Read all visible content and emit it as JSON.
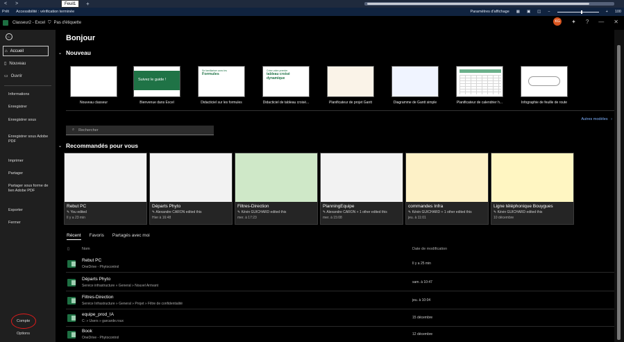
{
  "browser": {
    "back": "<",
    "forward": ">",
    "sheet_tab": "Feuil1",
    "new_tab": "+"
  },
  "statusbar": {
    "ready": "Prêt",
    "accessibility": "Accessibilité : vérification terminée",
    "display_settings": "Paramètres d'affichage",
    "zoom": "100"
  },
  "titlebar": {
    "filename": "Classeur2 - Excel",
    "label": "Pas d'étiquette",
    "avatar": "KG",
    "help": "?"
  },
  "leftnav": {
    "items": [
      {
        "label": "Accueil"
      },
      {
        "label": "Nouveau"
      },
      {
        "label": "Ouvrir"
      }
    ],
    "sub": [
      "Informations",
      "Enregistrer",
      "Enregistrer sous",
      "Enregistrer sous Adobe PDF",
      "Imprimer",
      "Partager",
      "Partager sous forme de lien Adobe PDF",
      "Exporter",
      "Fermer"
    ],
    "compte": "Compte",
    "options": "Options"
  },
  "main": {
    "greeting": "Bonjour",
    "new_section": "Nouveau",
    "templates": [
      {
        "label": "Nouveau classeur",
        "thumb": ""
      },
      {
        "label": "Bienvenue dans Excel",
        "thumb": "Suivez le guide !"
      },
      {
        "label": "Didacticiel sur les formules",
        "thumb": "Formules",
        "thumb_pre": "Se familiariser avec les"
      },
      {
        "label": "Didacticiel de tableau croisé...",
        "thumb": "tableau croisé dynamique",
        "thumb_pre": "Créer votre premier"
      },
      {
        "label": "Planificateur de projet Gantt"
      },
      {
        "label": "Diagramme de Gantt simple"
      },
      {
        "label": "Planificateur de calendrier h..."
      },
      {
        "label": "Infographie de feuille de route"
      }
    ],
    "more_templates": "Autres modèles",
    "search_placeholder": "Rechercher",
    "recommended_section": "Recommandés pour vous",
    "recommended": [
      {
        "title": "Rebut PC",
        "editor": "You edited",
        "date": "Il y a 23 min"
      },
      {
        "title": "Départs Phyto",
        "editor": "Alexandre CARON edited this",
        "date": "Hier à 16:48"
      },
      {
        "title": "Filtres-Direction",
        "editor": "Kévin GUICHARD edited this",
        "date": "mer. à 17:23"
      },
      {
        "title": "PlanningEquipe",
        "editor": "Alexandre CARON + 1 other edited this",
        "date": "mer. à 15:08"
      },
      {
        "title": "commandes Infra",
        "editor": "Kévin GUICHARD + 1 other edited this",
        "date": "jeu. à 11:01"
      },
      {
        "title": "Ligne téléphonique Bouygues",
        "editor": "Kévin GUICHARD edited this",
        "date": "10 décembre"
      }
    ],
    "tabs": [
      "Récent",
      "Favoris",
      "Partagés avec moi"
    ],
    "list_header": {
      "name": "Nom",
      "date": "Date de modification"
    },
    "files": [
      {
        "name": "Rebut PC",
        "path": "OneDrive - Phytocontrol",
        "date": "Il y a 25 min"
      },
      {
        "name": "Départs Phyto",
        "path": "Service infrastructure » General » Nouvel Arrivant",
        "date": "sam. à 10:47"
      },
      {
        "name": "Filtres-Direction",
        "path": "Service Infrastructure » General » Projet » Filtre de confidentialité",
        "date": "jeu. à 10:04"
      },
      {
        "name": "equipe_prod_IA",
        "path": "C: » Users » garcarde.roux",
        "date": "15 décembre"
      },
      {
        "name": "Book",
        "path": "OneDrive - Phytocontrol",
        "date": "12 décembre"
      }
    ]
  }
}
